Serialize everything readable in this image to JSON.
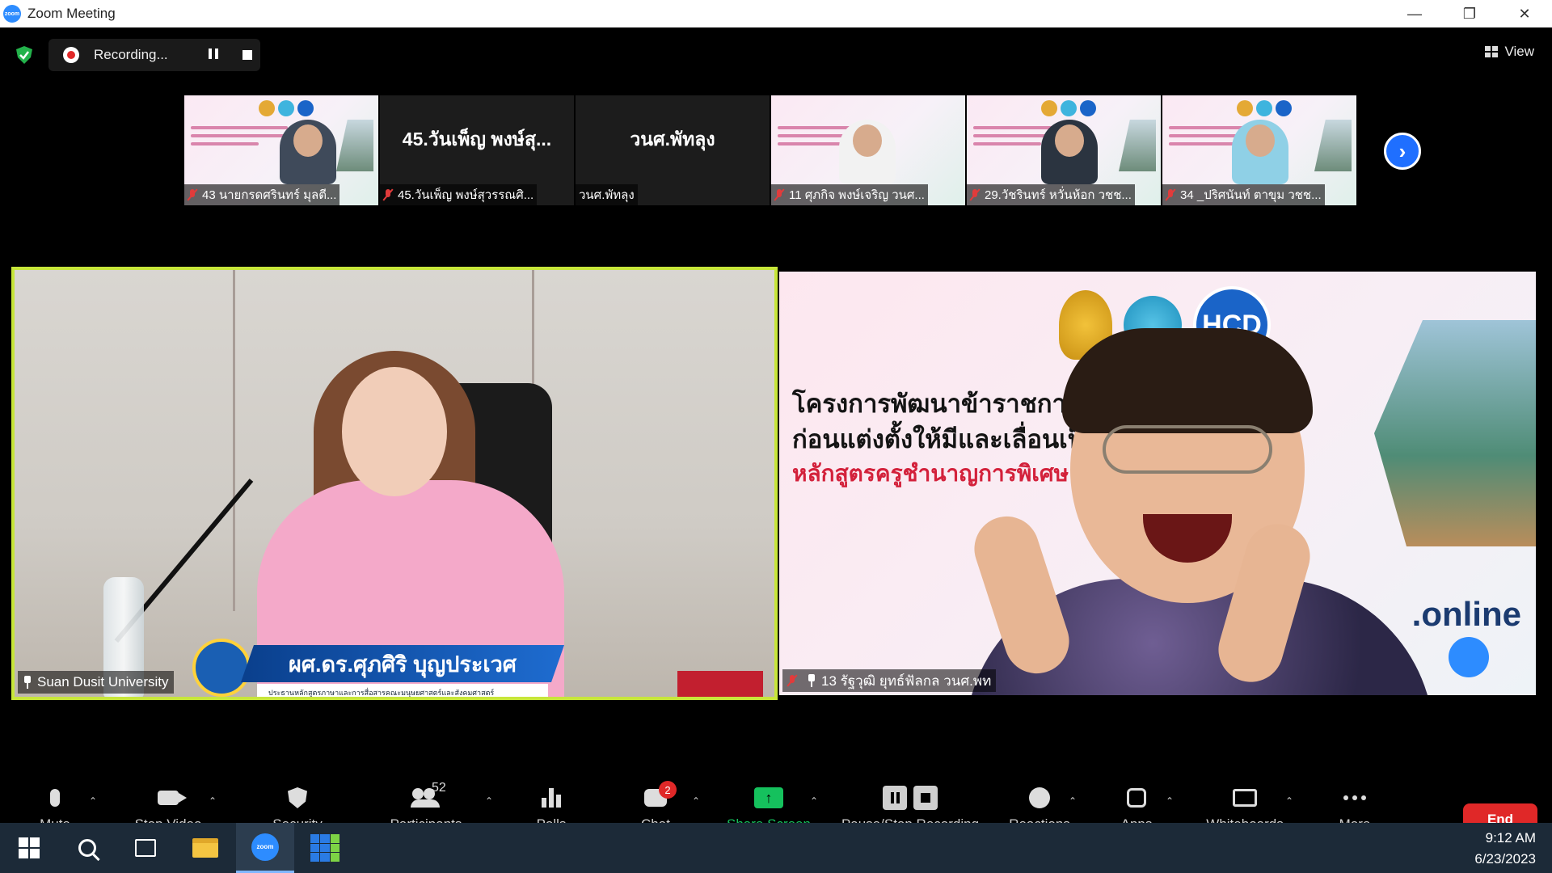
{
  "window": {
    "title": "Zoom Meeting",
    "app_logo_text": "zoom"
  },
  "top_bar": {
    "recording_label": "Recording...",
    "view_label": "View"
  },
  "thumbnails": [
    {
      "name": "43 นายกรดศรินทร์ มุลตี...",
      "kind": "video",
      "muted": true
    },
    {
      "name": "45.วันเพ็ญ พงษ์สุวรรณศิ...",
      "kind": "name",
      "center_text": "45.วันเพ็ญ พงษ์สุ...",
      "muted": true
    },
    {
      "name": "วนศ.พัทลุง",
      "kind": "name",
      "center_text": "วนศ.พัทลุง",
      "muted": false
    },
    {
      "name": "11 ศุภกิจ พงษ์เจริญ วนศ...",
      "kind": "video",
      "muted": true
    },
    {
      "name": "29.วัชรินทร์ หวั่นห้อก วชช...",
      "kind": "video",
      "muted": true
    },
    {
      "name": "34 _ปริศนันท์ ตาขุม วชช...",
      "kind": "video",
      "muted": true
    }
  ],
  "tiles": {
    "left": {
      "participant_label": "Suan Dusit University",
      "lower_third_name": "ผศ.ดร.ศุภศิริ บุญประเวศ",
      "lower_third_subtitle": "ประธานหลักสูตรภาษาและการสื่อสารคณะมนุษยศาสตร์และสังคมศาสตร์",
      "active_speaker_color": "#c7e63a"
    },
    "right": {
      "participant_label": "13 รัฐวุฒิ ยุทธ์ฟัลกล วนศ.พท",
      "slide_logo_text": "HCD",
      "slide_line1": "โครงการพัฒนาข้าราชการครู                     งการศึกษา",
      "slide_line2": "ก่อนแต่งตั้งให้มีและเลื่อนเป็",
      "slide_line3": "หลักสูตรครูชำนาญการพิเศษ",
      "slide_online": ".online"
    }
  },
  "toolbar": {
    "mute": "Mute",
    "stop_video": "Stop Video",
    "security": "Security",
    "participants": "Participants",
    "participants_count": "52",
    "polls": "Polls",
    "chat": "Chat",
    "chat_badge": "2",
    "share_screen": "Share Screen",
    "share_color": "#15c15d",
    "pause_stop_recording": "Pause/Stop Recording",
    "reactions": "Reactions",
    "apps": "Apps",
    "whiteboards": "Whiteboards",
    "more": "More",
    "end": "End",
    "end_color": "#e02828"
  },
  "taskbar": {
    "time": "9:12 AM",
    "date": "6/23/2023",
    "zoom_text": "zoom"
  },
  "icons": [
    "shield-icon",
    "record-icon",
    "pause-icon",
    "stop-icon",
    "grid-view-icon",
    "mic-muted-icon",
    "chevron-right-icon",
    "pin-icon",
    "microphone-icon",
    "camera-icon",
    "security-shield-icon",
    "participants-icon",
    "polls-icon",
    "chat-icon",
    "share-screen-icon",
    "reactions-icon",
    "apps-icon",
    "whiteboard-icon",
    "more-icon",
    "windows-start-icon",
    "search-icon",
    "task-view-icon",
    "file-explorer-icon",
    "zoom-app-icon",
    "store-icon"
  ]
}
